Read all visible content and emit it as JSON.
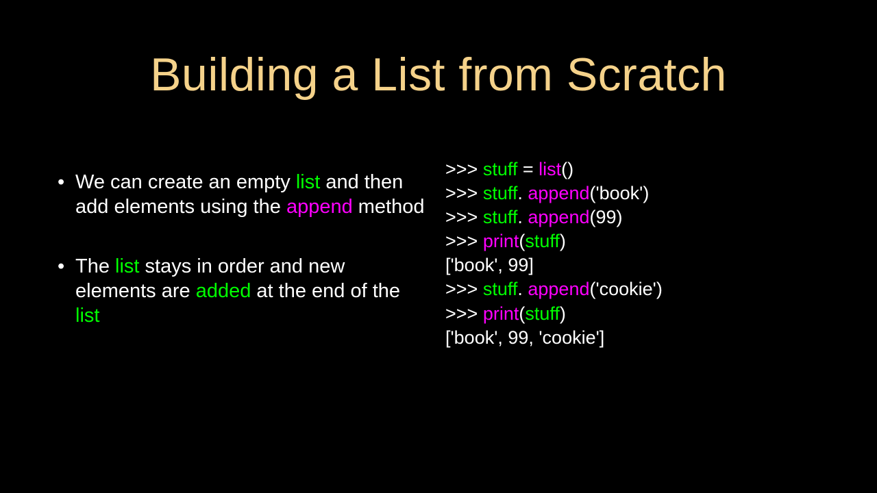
{
  "title": "Building a List from Scratch",
  "bullets": [
    {
      "parts": [
        {
          "t": "We can create an empty ",
          "c": ""
        },
        {
          "t": "list",
          "c": "hl-green"
        },
        {
          "t": " and then add elements using the ",
          "c": ""
        },
        {
          "t": "append",
          "c": "hl-magenta"
        },
        {
          "t": " method",
          "c": ""
        }
      ]
    },
    {
      "parts": [
        {
          "t": "The ",
          "c": ""
        },
        {
          "t": "list",
          "c": "hl-green"
        },
        {
          "t": " stays in order and new elements are ",
          "c": ""
        },
        {
          "t": "added",
          "c": "hl-green"
        },
        {
          "t": " at the end of the ",
          "c": ""
        },
        {
          "t": "list",
          "c": "hl-green"
        }
      ]
    }
  ],
  "code": [
    [
      {
        "t": ">>> ",
        "c": ""
      },
      {
        "t": "stuff",
        "c": "hl-green"
      },
      {
        "t": " = ",
        "c": ""
      },
      {
        "t": "list",
        "c": "hl-magenta"
      },
      {
        "t": "()",
        "c": ""
      }
    ],
    [
      {
        "t": ">>> ",
        "c": ""
      },
      {
        "t": "stuff",
        "c": "hl-green"
      },
      {
        "t": ". ",
        "c": ""
      },
      {
        "t": "append",
        "c": "hl-magenta"
      },
      {
        "t": "('book')",
        "c": ""
      }
    ],
    [
      {
        "t": ">>> ",
        "c": ""
      },
      {
        "t": "stuff",
        "c": "hl-green"
      },
      {
        "t": ". ",
        "c": ""
      },
      {
        "t": "append",
        "c": "hl-magenta"
      },
      {
        "t": "(99)",
        "c": ""
      }
    ],
    [
      {
        "t": ">>> ",
        "c": ""
      },
      {
        "t": "print",
        "c": "hl-magenta"
      },
      {
        "t": "(",
        "c": ""
      },
      {
        "t": "stuff",
        "c": "hl-green"
      },
      {
        "t": ")",
        "c": ""
      }
    ],
    [
      {
        "t": "['book', 99]",
        "c": ""
      }
    ],
    [
      {
        "t": ">>> ",
        "c": ""
      },
      {
        "t": "stuff",
        "c": "hl-green"
      },
      {
        "t": ". ",
        "c": ""
      },
      {
        "t": "append",
        "c": "hl-magenta"
      },
      {
        "t": "('cookie')",
        "c": ""
      }
    ],
    [
      {
        "t": ">>> ",
        "c": ""
      },
      {
        "t": "print",
        "c": "hl-magenta"
      },
      {
        "t": "(",
        "c": ""
      },
      {
        "t": "stuff",
        "c": "hl-green"
      },
      {
        "t": ")",
        "c": ""
      }
    ],
    [
      {
        "t": "['book', 99, 'cookie']",
        "c": ""
      }
    ]
  ]
}
